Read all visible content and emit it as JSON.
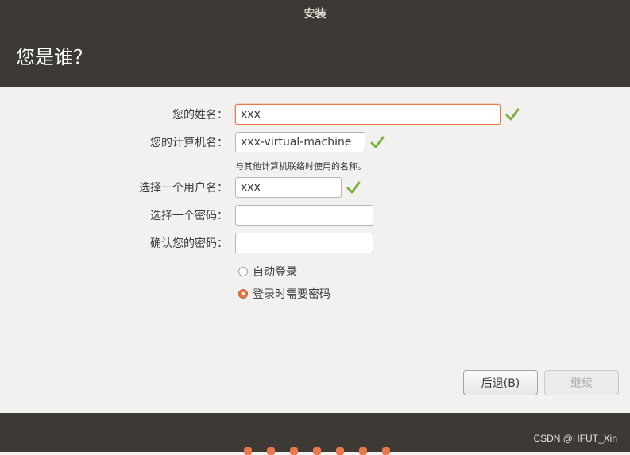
{
  "window": {
    "title": "安装"
  },
  "header": {
    "title": "您是谁？"
  },
  "form": {
    "name": {
      "label": "您的姓名：",
      "value": "xxx"
    },
    "computer_name": {
      "label": "您的计算机名：",
      "value": "xxx-virtual-machine",
      "hint": "与其他计算机联络时使用的名称。"
    },
    "username": {
      "label": "选择一个用户名：",
      "value": "xxx"
    },
    "password": {
      "label": "选择一个密码：",
      "value": ""
    },
    "confirm_password": {
      "label": "确认您的密码：",
      "value": ""
    },
    "login_options": [
      {
        "label": "自动登录",
        "selected": false
      },
      {
        "label": "登录时需要密码",
        "selected": true
      }
    ]
  },
  "buttons": {
    "back": "后退(B)",
    "continue": "继续"
  },
  "progress": {
    "total_steps": 7
  },
  "watermark": "CSDN @HFUT_Xin",
  "colors": {
    "accent": "#e9784d",
    "check_green": "#7ab33e",
    "header_bg": "#3d3935"
  }
}
